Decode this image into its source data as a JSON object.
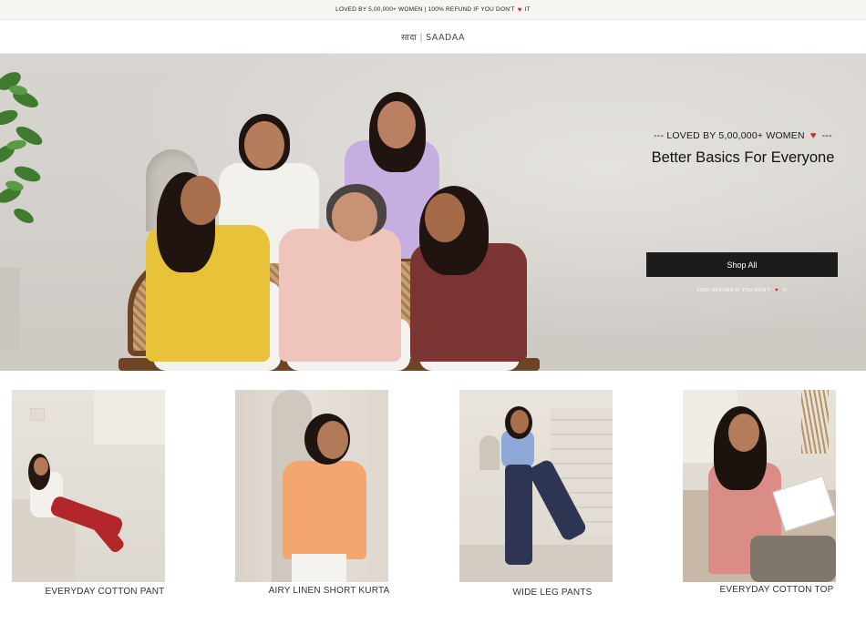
{
  "announcement": {
    "text_before": "LOVED BY 5,00,000+ WOMEN | 100% REFUND IF YOU DON'T",
    "heart": "♥",
    "text_after": "IT"
  },
  "header": {
    "logo_hindi": "सादा",
    "logo_sep": "|",
    "logo_text": "SAADAA"
  },
  "hero": {
    "tagline_before": "--- LOVED BY 5,00,000+ WOMEN",
    "heart": "♥",
    "tagline_after": "---",
    "title": "Better Basics For Everyone",
    "cta_label": "Shop All",
    "refund_before": "100% REFUND IF YOU DON'T",
    "refund_heart": "♥",
    "refund_after": "IT"
  },
  "products": [
    {
      "label": "EVERYDAY COTTON PANT"
    },
    {
      "label": "AIRY LINEN SHORT KURTA"
    },
    {
      "label": "WIDE LEG PANTS"
    },
    {
      "label": "EVERYDAY COTTON TOP"
    }
  ],
  "colors": {
    "accent_heart": "#d62828",
    "cta_bg": "#1c1c1c",
    "announce_bg": "#f7f5f2"
  }
}
